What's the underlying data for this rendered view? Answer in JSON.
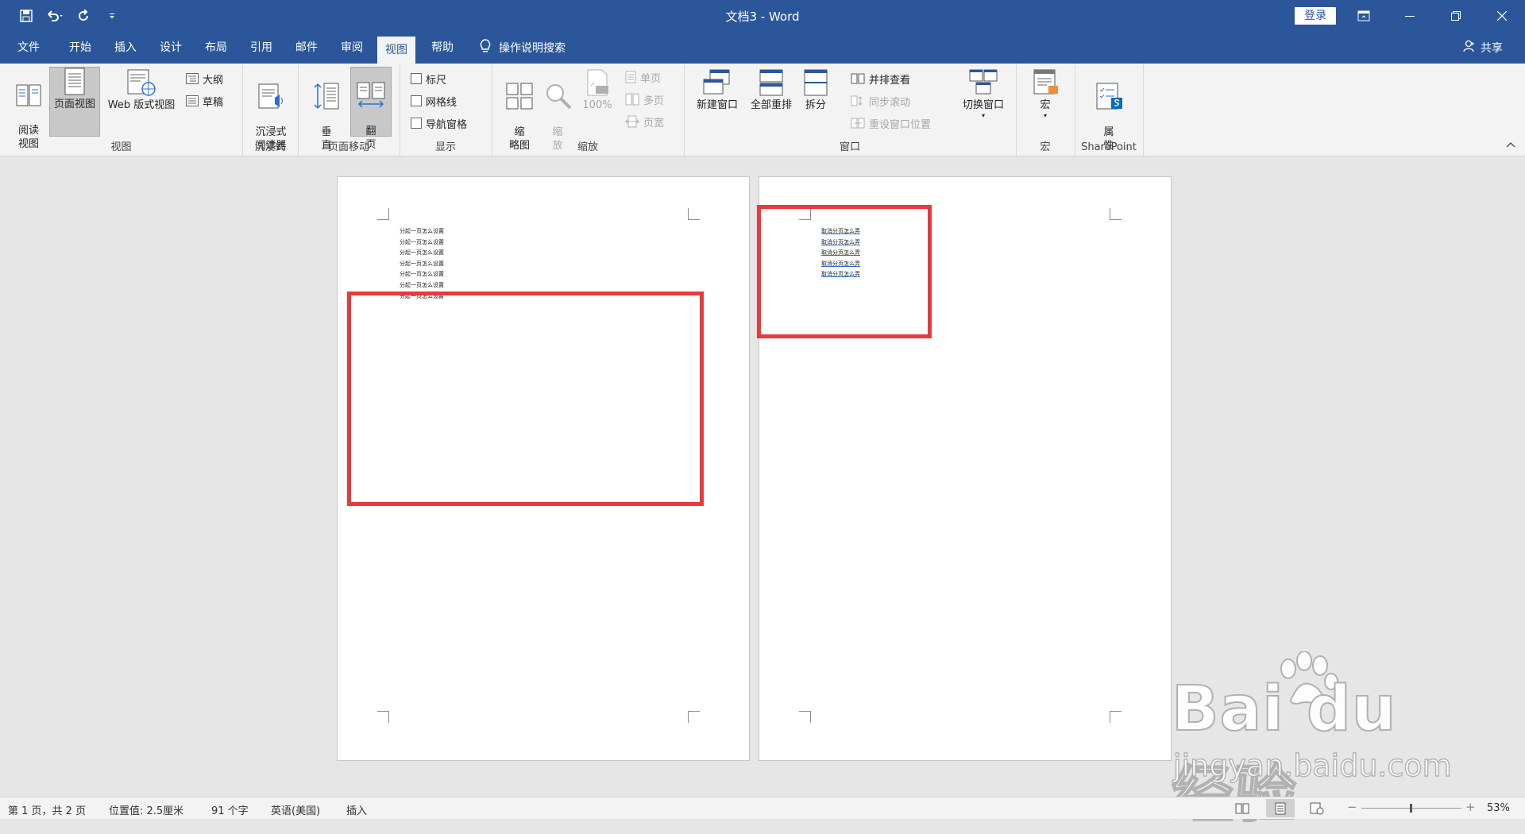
{
  "titlebar": {
    "title": "文档3  -  Word",
    "login": "登录"
  },
  "tabs": [
    {
      "label": "文件"
    },
    {
      "label": "开始"
    },
    {
      "label": "插入"
    },
    {
      "label": "设计"
    },
    {
      "label": "布局"
    },
    {
      "label": "引用"
    },
    {
      "label": "邮件"
    },
    {
      "label": "审阅"
    },
    {
      "label": "视图",
      "active": true
    },
    {
      "label": "帮助"
    }
  ],
  "search": {
    "label": "操作说明搜索"
  },
  "share": {
    "label": "共享"
  },
  "ribbon": {
    "views": {
      "read_mode": "阅读\n视图",
      "print_layout": "页面视图",
      "web_layout": "Web 版式视图",
      "outline": "大纲",
      "draft": "草稿",
      "label": "视图"
    },
    "immersive": {
      "reader": "沉浸式\n阅读器",
      "label": "沉浸式"
    },
    "page_movement": {
      "vertical": "垂\n直",
      "side_to_side": "翻\n页",
      "label": "页面移动"
    },
    "show": {
      "ruler": "标尺",
      "gridlines": "网格线",
      "nav_pane": "导航窗格",
      "label": "显示"
    },
    "zoom": {
      "thumbnails": "缩\n略图",
      "zoom": "缩\n放",
      "hundred": "100%",
      "one_page": "单页",
      "multiple_pages": "多页",
      "page_width": "页宽",
      "label": "缩放"
    },
    "window": {
      "new_window": "新建窗口",
      "arrange_all": "全部重排",
      "split": "拆分",
      "side_by_side": "并排查看",
      "sync_scroll": "同步滚动",
      "reset_position": "重设窗口位置",
      "switch_windows": "切换窗口",
      "label": "窗口"
    },
    "macros": {
      "macros": "宏",
      "label": "宏"
    },
    "sharepoint": {
      "properties": "属\n性",
      "label": "SharePoint"
    }
  },
  "document": {
    "page1_lines": [
      "分起一页怎么设置",
      "分起一页怎么设置",
      "分起一页怎么设置",
      "分起一页怎么设置",
      "分起一页怎么设置",
      "分起一页怎么设置",
      "分起一页怎么设置"
    ],
    "page2_lines": [
      "取消分页怎么弄",
      "取消分页怎么弄",
      "取消分页怎么弄",
      "取消分页怎么弄",
      "取消分页怎么弄"
    ]
  },
  "statusbar": {
    "page": "第 1 页，共 2 页",
    "position": "位置值: 2.5厘米",
    "words": "91 个字",
    "language": "英语(美国)",
    "mode": "插入",
    "zoom_percent": "53%"
  },
  "watermark": {
    "logo": "Bai du 经验",
    "url": "jingyan.baidu.com"
  },
  "colors": {
    "accent": "#2b579a",
    "highlight": "#e8393d",
    "ribbon_bg": "#f3f3f3"
  }
}
